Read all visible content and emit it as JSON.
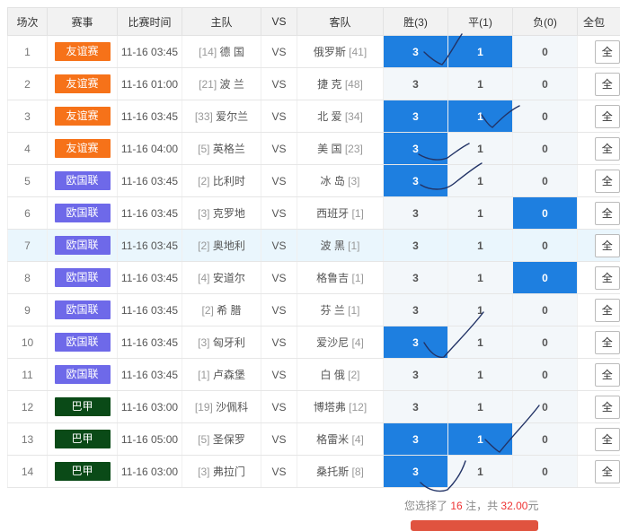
{
  "header": {
    "col_index": "场次",
    "col_league": "赛事",
    "col_time": "比赛时间",
    "col_home": "主队",
    "col_vs": "VS",
    "col_away": "客队",
    "col_win": "胜(3)",
    "col_draw": "平(1)",
    "col_lose": "负(0)",
    "col_all": "全包"
  },
  "odds_labels": {
    "win": "3",
    "draw": "1",
    "lose": "0"
  },
  "all_label": "全",
  "vs": "VS",
  "league_colors": {
    "友谊赛": "#f67219",
    "欧国联": "#6e69e9",
    "巴甲": "#0a4a17"
  },
  "matches": [
    {
      "no": "1",
      "league": "友谊赛",
      "time": "11-16 03:45",
      "home_rank": "[14]",
      "home": "德 国",
      "away": "俄罗斯",
      "away_rank": "[41]",
      "sel_win": true,
      "sel_draw": true,
      "sel_lose": false
    },
    {
      "no": "2",
      "league": "友谊赛",
      "time": "11-16 01:00",
      "home_rank": "[21]",
      "home": "波 兰",
      "away": "捷 克",
      "away_rank": "[48]",
      "sel_win": false,
      "sel_draw": false,
      "sel_lose": false
    },
    {
      "no": "3",
      "league": "友谊赛",
      "time": "11-16 03:45",
      "home_rank": "[33]",
      "home": "爱尔兰",
      "away": "北 爱",
      "away_rank": "[34]",
      "sel_win": true,
      "sel_draw": true,
      "sel_lose": false
    },
    {
      "no": "4",
      "league": "友谊赛",
      "time": "11-16 04:00",
      "home_rank": "[5]",
      "home": "英格兰",
      "away": "美 国",
      "away_rank": "[23]",
      "sel_win": true,
      "sel_draw": false,
      "sel_lose": false
    },
    {
      "no": "5",
      "league": "欧国联",
      "time": "11-16 03:45",
      "home_rank": "[2]",
      "home": "比利时",
      "away": "冰 岛",
      "away_rank": "[3]",
      "sel_win": true,
      "sel_draw": false,
      "sel_lose": false
    },
    {
      "no": "6",
      "league": "欧国联",
      "time": "11-16 03:45",
      "home_rank": "[3]",
      "home": "克罗地",
      "away": "西班牙",
      "away_rank": "[1]",
      "sel_win": false,
      "sel_draw": false,
      "sel_lose": true
    },
    {
      "no": "7",
      "league": "欧国联",
      "time": "11-16 03:45",
      "home_rank": "[2]",
      "home": "奥地利",
      "away": "波 黑",
      "away_rank": "[1]",
      "sel_win": false,
      "sel_draw": false,
      "sel_lose": false
    },
    {
      "no": "8",
      "league": "欧国联",
      "time": "11-16 03:45",
      "home_rank": "[4]",
      "home": "安道尔",
      "away": "格鲁吉",
      "away_rank": "[1]",
      "sel_win": false,
      "sel_draw": false,
      "sel_lose": true
    },
    {
      "no": "9",
      "league": "欧国联",
      "time": "11-16 03:45",
      "home_rank": "[2]",
      "home": "希 腊",
      "away": "芬 兰",
      "away_rank": "[1]",
      "sel_win": false,
      "sel_draw": false,
      "sel_lose": false
    },
    {
      "no": "10",
      "league": "欧国联",
      "time": "11-16 03:45",
      "home_rank": "[3]",
      "home": "匈牙利",
      "away": "爱沙尼",
      "away_rank": "[4]",
      "sel_win": true,
      "sel_draw": false,
      "sel_lose": false
    },
    {
      "no": "11",
      "league": "欧国联",
      "time": "11-16 03:45",
      "home_rank": "[1]",
      "home": "卢森堡",
      "away": "白 俄",
      "away_rank": "[2]",
      "sel_win": false,
      "sel_draw": false,
      "sel_lose": false
    },
    {
      "no": "12",
      "league": "巴甲",
      "time": "11-16 03:00",
      "home_rank": "[19]",
      "home": "沙佩科",
      "away": "博塔弗",
      "away_rank": "[12]",
      "sel_win": false,
      "sel_draw": false,
      "sel_lose": false
    },
    {
      "no": "13",
      "league": "巴甲",
      "time": "11-16 05:00",
      "home_rank": "[5]",
      "home": "圣保罗",
      "away": "格雷米",
      "away_rank": "[4]",
      "sel_win": true,
      "sel_draw": true,
      "sel_lose": false
    },
    {
      "no": "14",
      "league": "巴甲",
      "time": "11-16 03:00",
      "home_rank": "[3]",
      "home": "弗拉门",
      "away": "桑托斯",
      "away_rank": "[8]",
      "sel_win": true,
      "sel_draw": false,
      "sel_lose": false
    }
  ],
  "summary": {
    "prefix": "您选择了",
    "count": "16",
    "mid": "注，共",
    "amount": "32.00",
    "suffix": "元"
  }
}
